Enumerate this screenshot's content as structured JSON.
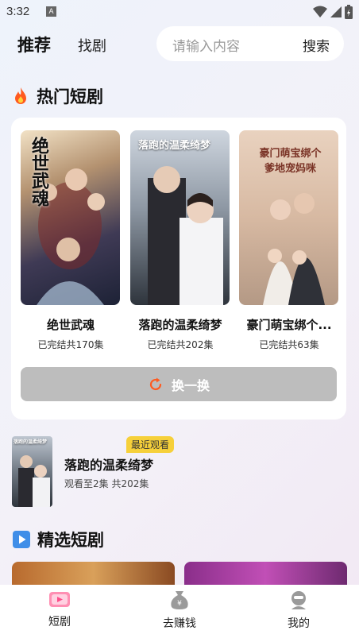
{
  "status": {
    "time": "3:32",
    "notif": "A"
  },
  "nav": {
    "tab_active": "推荐",
    "tab_other": "找剧"
  },
  "search": {
    "placeholder": "请输入内容",
    "button": "搜索"
  },
  "hot": {
    "title": "热门短剧",
    "items": [
      {
        "poster_title": "绝世武魂",
        "name": "绝世武魂",
        "status": "已完结共170集"
      },
      {
        "poster_title": "落跑的温柔绮梦",
        "name": "落跑的温柔绮梦",
        "status": "已完结共202集"
      },
      {
        "poster_title": "豪门萌宝绑个爹地宠妈咪",
        "name": "豪门萌宝绑个...",
        "status": "已完结共63集"
      }
    ],
    "swap_label": "换一换"
  },
  "recent": {
    "badge": "最近观看",
    "thumb_title": "落跑的温柔绮梦",
    "title": "落跑的温柔绮梦",
    "progress": "观看至2集 共202集"
  },
  "picks": {
    "title": "精选短剧"
  },
  "bottom": {
    "items": [
      {
        "label": "短剧"
      },
      {
        "label": "去赚钱"
      },
      {
        "label": "我的"
      }
    ]
  },
  "colors": {
    "accent": "#f6d03a",
    "swap_bg": "#bdbdbd",
    "fire": "#ff5a1f"
  },
  "icons": [
    "fire-icon",
    "play-icon",
    "refresh-icon",
    "shorts-icon",
    "coin-bag-icon",
    "profile-icon",
    "wifi-icon",
    "signal-icon",
    "battery-icon"
  ]
}
